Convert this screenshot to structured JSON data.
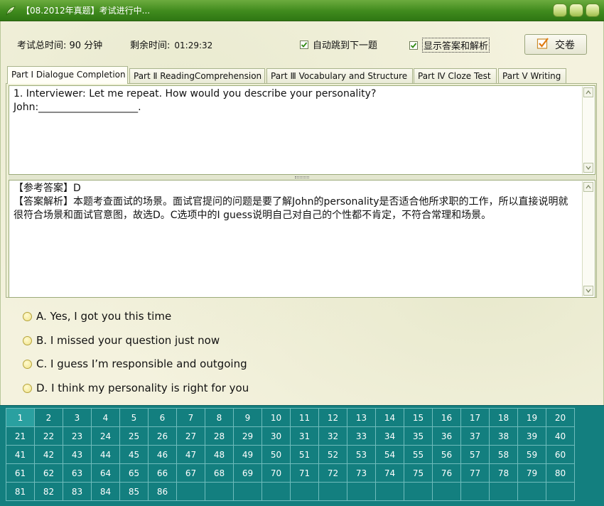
{
  "window": {
    "title": "【08.2012年真题】考试进行中...",
    "buttons": [
      "minimize",
      "maximize",
      "close"
    ]
  },
  "header": {
    "total_time_label": "考试总时间: 90 分钟",
    "remaining_label": "剩余时间:",
    "remaining_value": "01:29:32",
    "auto_next_label": "自动跳到下一题",
    "auto_next_checked": true,
    "show_answer_label": "显示答案和解析",
    "show_answer_checked": true,
    "submit_label": "交卷"
  },
  "tabs": [
    {
      "label": "Part Ⅰ Dialogue Completion",
      "active": true
    },
    {
      "label": "Part Ⅱ ReadingComprehension",
      "active": false
    },
    {
      "label": "Part Ⅲ Vocabulary and Structure",
      "active": false
    },
    {
      "label": "Part Ⅳ Cloze Test",
      "active": false
    },
    {
      "label": "Part Ⅴ Writing",
      "active": false
    }
  ],
  "question": {
    "line1": "1. Interviewer: Let me repeat. How would you describe your personality?",
    "line2": "John:____________________."
  },
  "answer": {
    "ref_label": "【参考答案】",
    "ref_value": "D",
    "explain_label": "【答案解析】",
    "explain_text": "本题考查面试的场景。面试官提问的问题是要了解John的personality是否适合他所求职的工作，所以直接说明就很符合场景和面试官意图，故选D。C选项中的I guess说明自己对自己的个性都不肯定，不符合常理和场景。"
  },
  "options": [
    "A. Yes, I got you this time",
    "B. I missed your question just now",
    "C. I guess I’m responsible and outgoing",
    "D. I think my personality is right for you"
  ],
  "question_grid": {
    "total": 86,
    "current": 1,
    "numbers": [
      "1",
      "2",
      "3",
      "4",
      "5",
      "6",
      "7",
      "8",
      "9",
      "10",
      "11",
      "12",
      "13",
      "14",
      "15",
      "16",
      "17",
      "18",
      "19",
      "20",
      "21",
      "22",
      "23",
      "24",
      "25",
      "26",
      "27",
      "28",
      "29",
      "30",
      "31",
      "32",
      "33",
      "34",
      "35",
      "36",
      "37",
      "38",
      "39",
      "40",
      "41",
      "42",
      "43",
      "44",
      "45",
      "46",
      "47",
      "48",
      "49",
      "50",
      "51",
      "52",
      "53",
      "54",
      "55",
      "56",
      "57",
      "58",
      "59",
      "60",
      "61",
      "62",
      "63",
      "64",
      "65",
      "66",
      "67",
      "68",
      "69",
      "70",
      "71",
      "72",
      "73",
      "74",
      "75",
      "76",
      "77",
      "78",
      "79",
      "80",
      "81",
      "82",
      "83",
      "84",
      "85",
      "86"
    ]
  },
  "colors": {
    "titlebar": "#3f8a1d",
    "grid_bg": "#137f7f",
    "page_bg": "#f4f2de"
  }
}
